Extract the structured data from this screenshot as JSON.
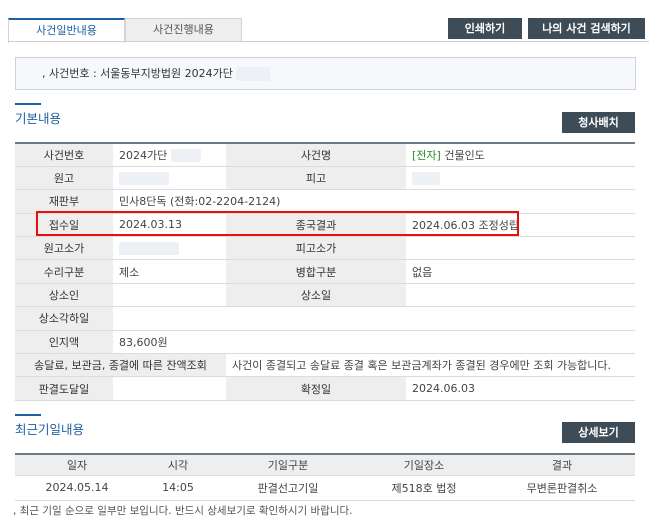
{
  "tabs": [
    {
      "label": "사건일반내용"
    },
    {
      "label": "사건진행내용"
    }
  ],
  "toolbar": {
    "print_label": "인쇄하기",
    "mycase_label": "나의 사건 검색하기"
  },
  "case_banner": {
    "prefix": ",",
    "text": "사건번호 : 서울동부지방법원 2024가단"
  },
  "basic_section": {
    "title": "기본내용",
    "history_button": "청사배치",
    "rows": [
      {
        "h1": "사건번호",
        "v1": "2024가단",
        "h2": "사건명",
        "v2_tag": "[전자]",
        "v2": " 건물인도"
      },
      {
        "h1": "원고",
        "v1": "",
        "h2": "피고",
        "v2": ""
      },
      {
        "h1": "재판부",
        "v1": "민사8단독 (전화:02-2204-2124)"
      },
      {
        "h1": "접수일",
        "v1": "2024.03.13",
        "h2": "종국결과",
        "v2": "2024.06.03 조정성립"
      },
      {
        "h1": "원고소가",
        "v1": "",
        "h2": "피고소가",
        "v2": ""
      },
      {
        "h1": "수리구분",
        "v1": "제소",
        "h2": "병합구분",
        "v2": "없음"
      },
      {
        "h1": "상소인",
        "v1": "",
        "h2": "상소일",
        "v2": ""
      },
      {
        "h1": "상소각하일",
        "v1": ""
      },
      {
        "h1": "인지액",
        "v1": "83,600원"
      },
      {
        "h1": "송달료, 보관금, 종결에 따른 잔액조회",
        "v1": "사건이 종결되고 송달료 종결 혹은 보관금계좌가 종결된 경우에만 조회 가능합니다."
      },
      {
        "h1": "판결도달일",
        "v1": "",
        "h2": "확정일",
        "v2": "2024.06.03"
      }
    ]
  },
  "recent_section": {
    "title": "최근기일내용",
    "detail_button": "상세보기",
    "columns": [
      "일자",
      "시각",
      "기일구분",
      "기일장소",
      "결과"
    ],
    "rows": [
      [
        "2024.05.14",
        "14:05",
        "판결선고기일",
        "제518호 법정",
        "무변론판결취소"
      ]
    ],
    "note": ", 최근 기일 순으로 일부만 보입니다. 반드시 상세보기로 확인하시기 바랍니다."
  },
  "colors": {
    "accent": "#1d5fa3",
    "button_bg": "#3e4c57",
    "highlight_box": "#e8100f",
    "electronic_tag": "#2a8a2a"
  }
}
